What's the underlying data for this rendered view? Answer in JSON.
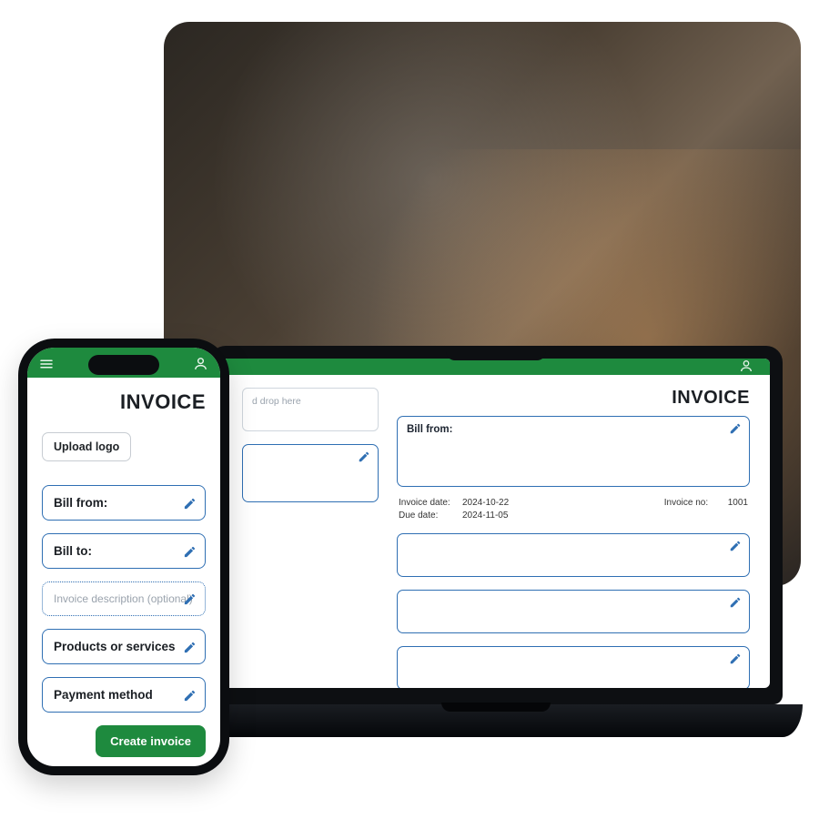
{
  "colors": {
    "brand_green": "#1e8a3e",
    "accent_blue": "#2f6fb3"
  },
  "laptop": {
    "title": "INVOICE",
    "drop_hint": "d drop here",
    "billfrom_label": "Bill from:",
    "meta": {
      "invoice_date_label": "Invoice date:",
      "invoice_date_value": "2024-10-22",
      "due_date_label": "Due date:",
      "due_date_value": "2024-11-05",
      "invoice_no_label": "Invoice no:",
      "invoice_no_value": "1001"
    }
  },
  "phone": {
    "title": "INVOICE",
    "upload_label": "Upload logo",
    "cards": {
      "bill_from": "Bill from:",
      "bill_to": "Bill to:",
      "description_placeholder": "Invoice description (optional)",
      "products": "Products or services",
      "payment": "Payment method"
    },
    "create_button": "Create invoice"
  }
}
